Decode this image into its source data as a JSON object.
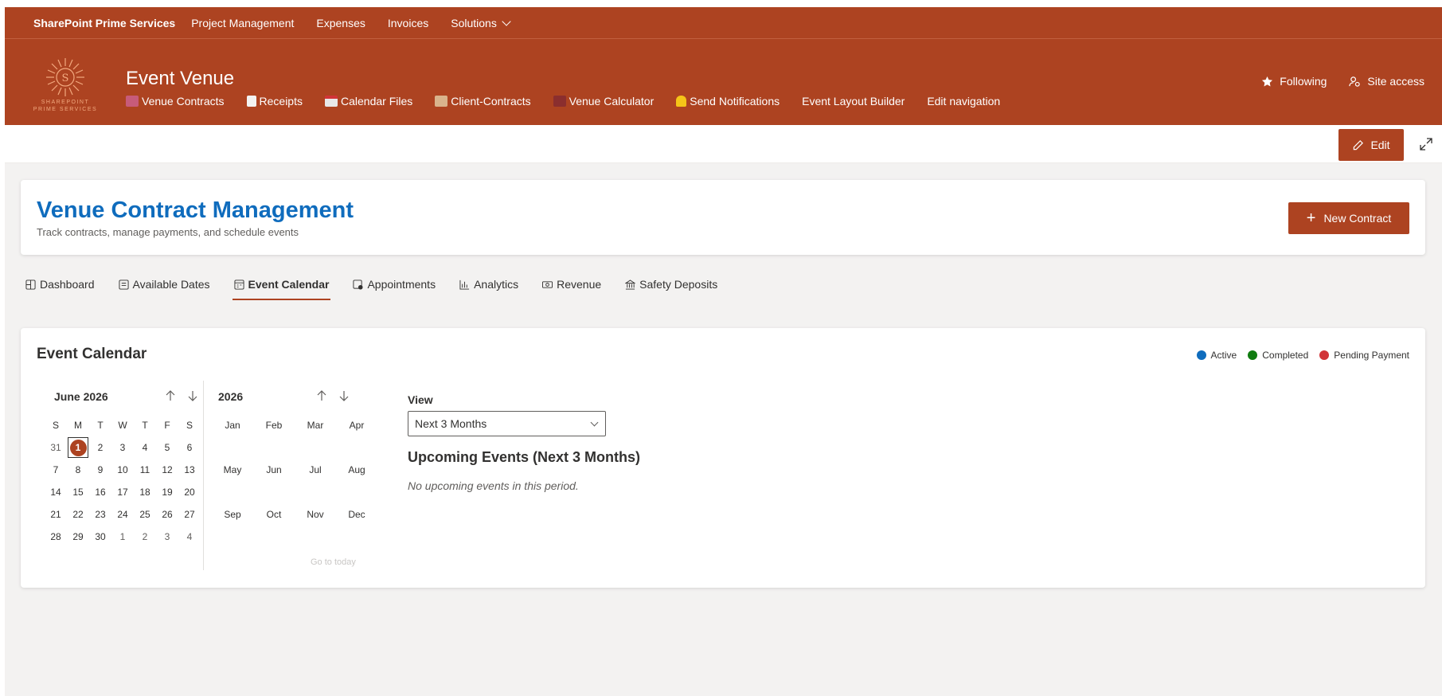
{
  "suitebar": {
    "brand": "SharePoint Prime Services",
    "links": [
      "Project Management",
      "Expenses",
      "Invoices",
      "Solutions"
    ]
  },
  "site": {
    "title": "Event Venue",
    "logo_text_1": "SHAREPOINT",
    "logo_text_2": "PRIME SERVICES",
    "nav": [
      {
        "label": "Venue Contracts",
        "icon": "contract-emoji-icon",
        "color": "#c75b7a"
      },
      {
        "label": "Receipts",
        "icon": "receipt-emoji-icon",
        "color": "#f3f2f1"
      },
      {
        "label": "Calendar Files",
        "icon": "calendar-emoji-icon",
        "color": "#e8e8e8"
      },
      {
        "label": "Client-Contracts",
        "icon": "scroll-emoji-icon",
        "color": "#d9b38c"
      },
      {
        "label": "Venue Calculator",
        "icon": "abacus-emoji-icon",
        "color": "#8b2e2e"
      },
      {
        "label": "Send Notifications",
        "icon": "bell-emoji-icon",
        "color": "#f5c518"
      },
      {
        "label": "Event Layout Builder",
        "icon": "",
        "color": ""
      },
      {
        "label": "Edit navigation",
        "icon": "",
        "color": ""
      }
    ],
    "following": "Following",
    "site_access": "Site access"
  },
  "commandbar": {
    "edit": "Edit"
  },
  "header": {
    "title": "Venue Contract Management",
    "subtitle": "Track contracts, manage payments, and schedule events",
    "new_contract": "New Contract"
  },
  "tabs": [
    {
      "label": "Dashboard",
      "icon": "dashboard-icon"
    },
    {
      "label": "Available Dates",
      "icon": "calendar-list-icon"
    },
    {
      "label": "Event Calendar",
      "icon": "calendar-icon",
      "active": true
    },
    {
      "label": "Appointments",
      "icon": "appointment-icon"
    },
    {
      "label": "Analytics",
      "icon": "chart-icon"
    },
    {
      "label": "Revenue",
      "icon": "money-icon"
    },
    {
      "label": "Safety Deposits",
      "icon": "bank-icon"
    }
  ],
  "calendar": {
    "title": "Event Calendar",
    "legend": [
      {
        "label": "Active",
        "color": "#0f6cbd"
      },
      {
        "label": "Completed",
        "color": "#107c10"
      },
      {
        "label": "Pending Payment",
        "color": "#d13438"
      }
    ],
    "day_picker": {
      "month_label": "June 2026",
      "weekdays": [
        "S",
        "M",
        "T",
        "W",
        "T",
        "F",
        "S"
      ],
      "weeks": [
        [
          "31",
          "1",
          "2",
          "3",
          "4",
          "5",
          "6"
        ],
        [
          "7",
          "8",
          "9",
          "10",
          "11",
          "12",
          "13"
        ],
        [
          "14",
          "15",
          "16",
          "17",
          "18",
          "19",
          "20"
        ],
        [
          "21",
          "22",
          "23",
          "24",
          "25",
          "26",
          "27"
        ],
        [
          "28",
          "29",
          "30",
          "1",
          "2",
          "3",
          "4"
        ]
      ],
      "selected": "1"
    },
    "month_picker": {
      "year": "2026",
      "months": [
        "Jan",
        "Feb",
        "Mar",
        "Apr",
        "May",
        "Jun",
        "Jul",
        "Aug",
        "Sep",
        "Oct",
        "Nov",
        "Dec"
      ],
      "go_to_today": "Go to today"
    },
    "view_label": "View",
    "view_value": "Next 3 Months",
    "upcoming_title": "Upcoming Events (Next 3 Months)",
    "no_events": "No upcoming events in this period."
  }
}
